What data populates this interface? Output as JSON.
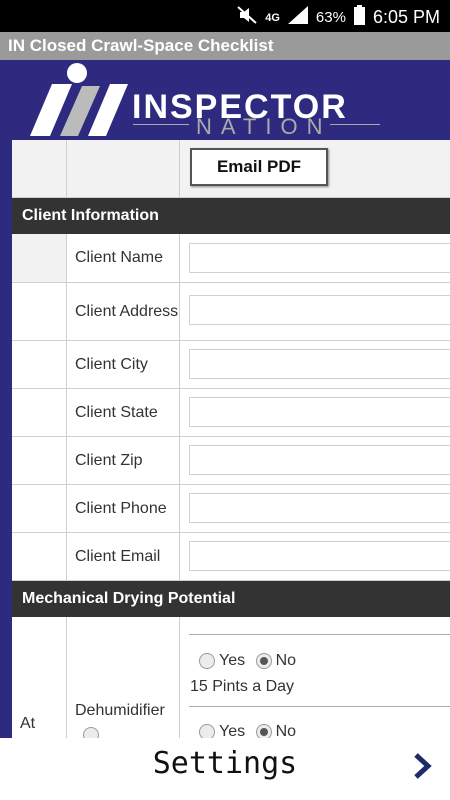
{
  "status_bar": {
    "battery": "63%",
    "time": "6:05 PM",
    "network": "4G"
  },
  "app_title": "IN Closed Crawl-Space Checklist",
  "brand": {
    "name": "INSPECTOR",
    "subtitle": "NATION"
  },
  "actions": {
    "email_pdf": "Email PDF"
  },
  "sections": {
    "client_info": "Client Information",
    "mechanical": "Mechanical Drying Potential"
  },
  "client_fields": [
    {
      "label": "Client Name",
      "value": ""
    },
    {
      "label": "Client Address",
      "value": ""
    },
    {
      "label": "Client City",
      "value": ""
    },
    {
      "label": "Client State",
      "value": ""
    },
    {
      "label": "Client Zip",
      "value": ""
    },
    {
      "label": "Client Phone",
      "value": ""
    },
    {
      "label": "Client Email",
      "value": ""
    }
  ],
  "mechanical_row": {
    "left_label": "At least",
    "label": "Dehumidifier",
    "option_yes": "Yes",
    "option_no": "No",
    "option_description": "15 Pints a Day",
    "selected": "No"
  },
  "footer": {
    "settings_label": "Settings"
  },
  "colors": {
    "brand": "#2e2a80",
    "section_header": "#333333",
    "titlebar": "#9a9a9a"
  }
}
